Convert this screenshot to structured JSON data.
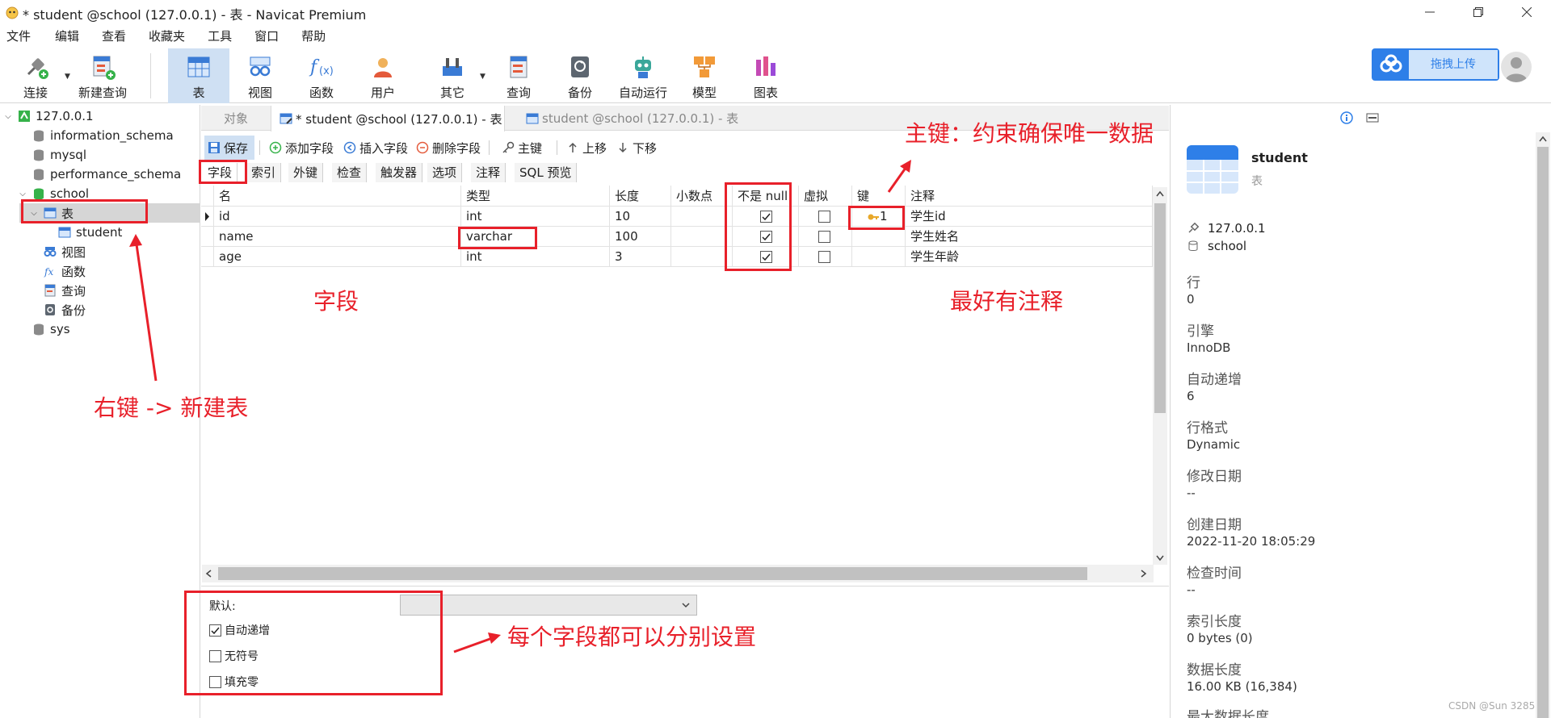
{
  "window": {
    "title": "* student @school (127.0.0.1) - 表 - Navicat Premium"
  },
  "menu": [
    "文件",
    "编辑",
    "查看",
    "收藏夹",
    "工具",
    "窗口",
    "帮助"
  ],
  "toolbar": {
    "buttons": [
      "连接",
      "新建查询",
      "表",
      "视图",
      "函数",
      "用户",
      "其它",
      "查询",
      "备份",
      "自动运行",
      "模型",
      "图表"
    ],
    "active": "表",
    "upload_label": "拖拽上传"
  },
  "tree": {
    "connection": "127.0.0.1",
    "databases": [
      "information_schema",
      "mysql",
      "performance_schema",
      "school",
      "sys"
    ],
    "school_children": [
      "表",
      "视图",
      "函数",
      "查询",
      "备份"
    ],
    "table_item": "student"
  },
  "tabs": [
    "对象",
    "* student @school (127.0.0.1) - 表",
    "student @school (127.0.0.1) - 表"
  ],
  "edit_toolbar": [
    "保存",
    "添加字段",
    "插入字段",
    "删除字段",
    "主键",
    "上移",
    "下移"
  ],
  "sub_tabs": [
    "字段",
    "索引",
    "外键",
    "检查",
    "触发器",
    "选项",
    "注释",
    "SQL 预览"
  ],
  "grid": {
    "columns": [
      "名",
      "类型",
      "长度",
      "小数点",
      "不是 null",
      "虚拟",
      "键",
      "注释"
    ],
    "rows": [
      {
        "name": "id",
        "type": "int",
        "length": "10",
        "decimals": "",
        "not_null": true,
        "virtual": false,
        "key": "1",
        "comment": "学生id"
      },
      {
        "name": "name",
        "type": "varchar",
        "length": "100",
        "decimals": "",
        "not_null": true,
        "virtual": false,
        "key": "",
        "comment": "学生姓名"
      },
      {
        "name": "age",
        "type": "int",
        "length": "3",
        "decimals": "",
        "not_null": true,
        "virtual": false,
        "key": "",
        "comment": "学生年龄"
      }
    ]
  },
  "bottom": {
    "default_label": "默认:",
    "options": [
      {
        "label": "自动递增",
        "checked": true
      },
      {
        "label": "无符号",
        "checked": false
      },
      {
        "label": "填充零",
        "checked": false
      }
    ]
  },
  "info_panel": {
    "name": "student",
    "type": "表",
    "connection": "127.0.0.1",
    "database": "school",
    "fields": [
      {
        "label": "行",
        "value": "0"
      },
      {
        "label": "引擎",
        "value": "InnoDB"
      },
      {
        "label": "自动递增",
        "value": "6"
      },
      {
        "label": "行格式",
        "value": "Dynamic"
      },
      {
        "label": "修改日期",
        "value": "--"
      },
      {
        "label": "创建日期",
        "value": "2022-11-20 18:05:29"
      },
      {
        "label": "检查时间",
        "value": "--"
      },
      {
        "label": "索引长度",
        "value": "0 bytes (0)"
      },
      {
        "label": "数据长度",
        "value": "16.00 KB (16,384)"
      },
      {
        "label": "最大数据长度",
        "value": ""
      }
    ]
  },
  "annotations": {
    "primary_key": "主键：约束确保唯一数据",
    "fields": "字段",
    "comment": "最好有注释",
    "new_table": "右键 -> 新建表",
    "per_field": "每个字段都可以分别设置"
  },
  "watermark": "CSDN @Sun 3285",
  "colors": {
    "accent_red": "#e8202a",
    "selection": "#cfe0f3",
    "brand_blue": "#2e7fe8"
  }
}
